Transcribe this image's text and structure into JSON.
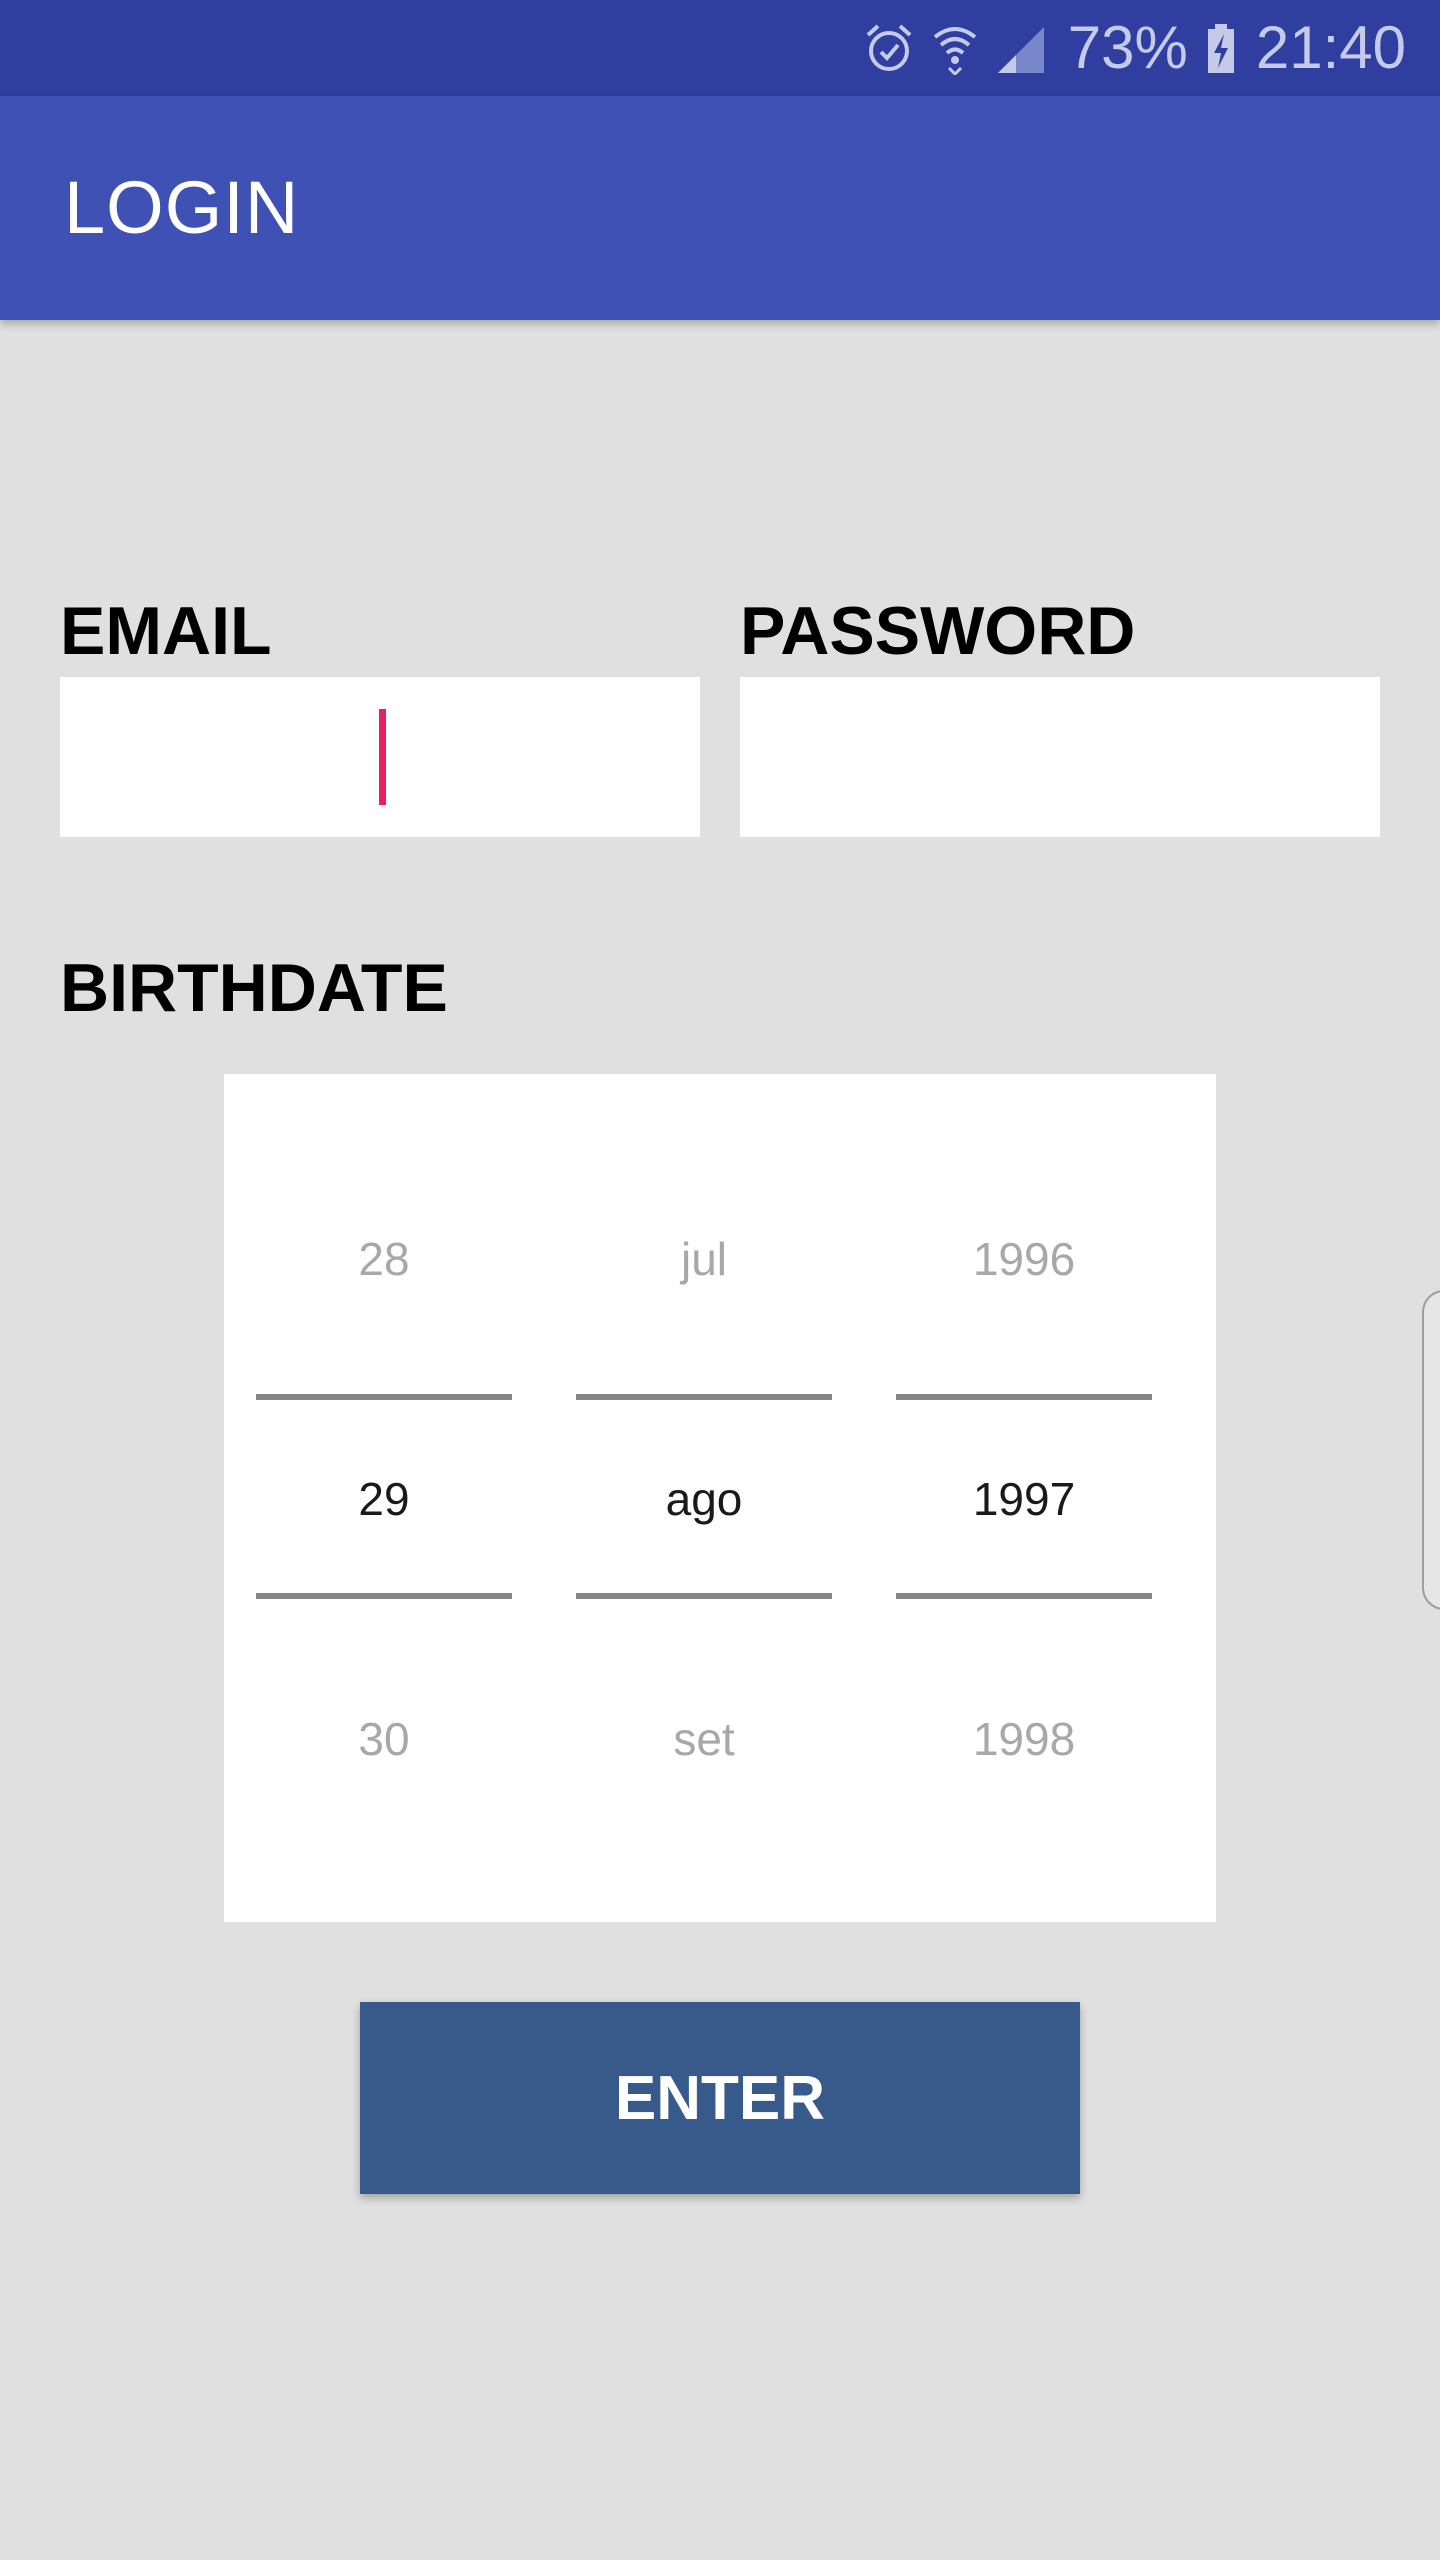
{
  "status_bar": {
    "battery": "73%",
    "time": "21:40",
    "icons": [
      "alarm-icon",
      "wifi-icon",
      "signal-icon",
      "battery-charging-icon"
    ]
  },
  "app_bar": {
    "title": "LOGIN"
  },
  "form": {
    "email_label": "EMAIL",
    "email_value": "",
    "password_label": "PASSWORD",
    "password_value": "",
    "birthdate_label": "BIRTHDATE"
  },
  "date_picker": {
    "day": {
      "prev": "28",
      "current": "29",
      "next": "30"
    },
    "month": {
      "prev": "jul",
      "current": "ago",
      "next": "set"
    },
    "year": {
      "prev": "1996",
      "current": "1997",
      "next": "1998"
    }
  },
  "enter_button": {
    "label": "ENTER"
  },
  "colors": {
    "status_bar": "#303f9f",
    "app_bar": "#3f51b5",
    "background": "#e0e0e0",
    "button": "#385a8b",
    "cursor": "#e91e63"
  }
}
